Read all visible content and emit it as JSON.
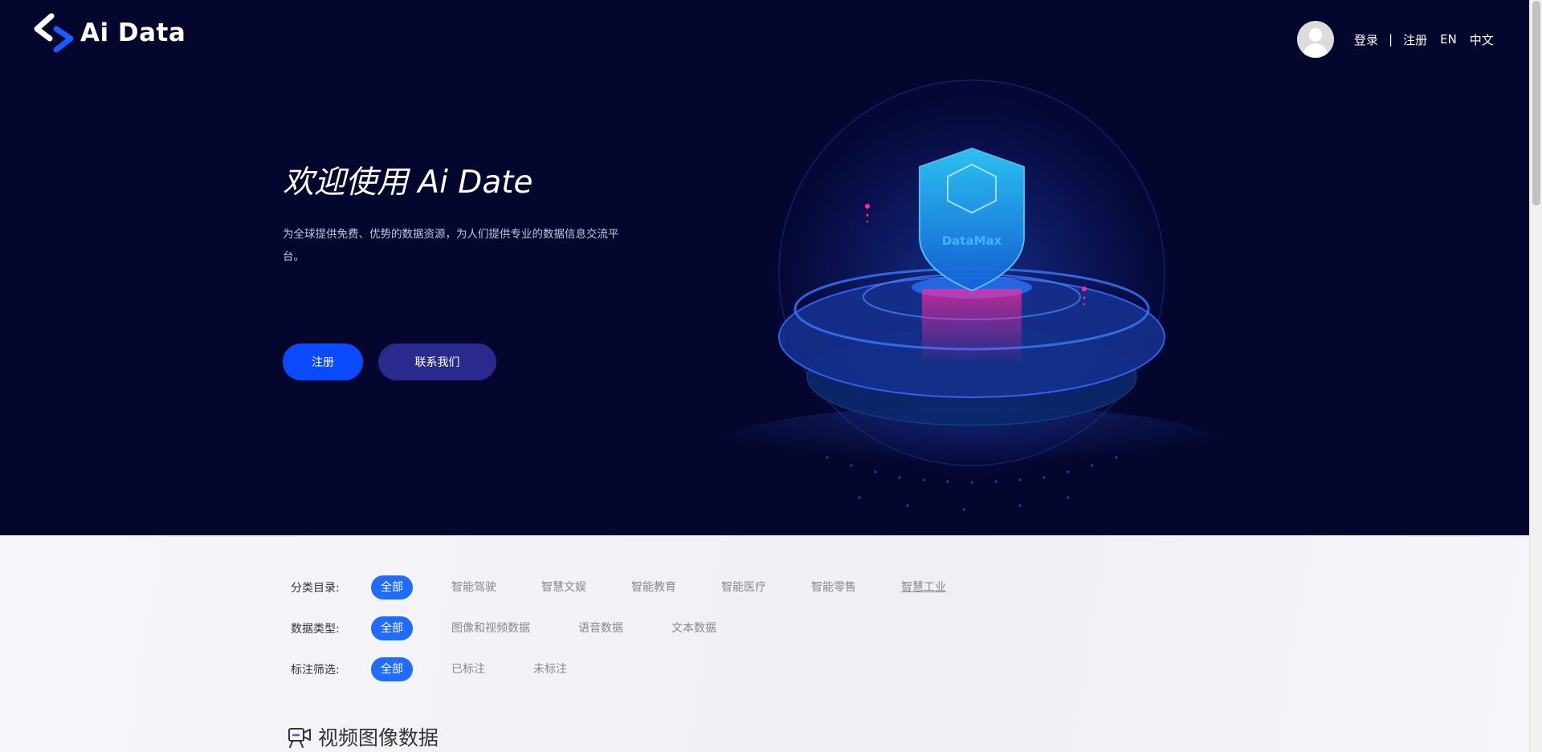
{
  "header": {
    "logo_text": "Ai Data",
    "nav": {
      "login": "登录",
      "separator": "|",
      "register": "注册",
      "lang_en": "EN",
      "lang_zh": "中文"
    }
  },
  "hero": {
    "title": "欢迎使用 Ai Date",
    "description": "为全球提供免费、优势的数据资源，为人们提供专业的数据信息交流平台。",
    "register_button": "注册",
    "contact_button": "联系我们",
    "illustration_label": "DataMax"
  },
  "filters": {
    "category": {
      "label": "分类目录:",
      "options": [
        "全部",
        "智能驾驶",
        "智慧文娱",
        "智能教育",
        "智能医疗",
        "智能零售",
        "智慧工业"
      ],
      "selected": "全部"
    },
    "data_type": {
      "label": "数据类型:",
      "options": [
        "全部",
        "图像和视频数据",
        "语音数据",
        "文本数据"
      ],
      "selected": "全部"
    },
    "annotation": {
      "label": "标注筛选:",
      "options": [
        "全部",
        "已标注",
        "未标注"
      ],
      "selected": "全部"
    }
  },
  "section": {
    "title": "视频图像数据",
    "icon": "video-camera-icon"
  },
  "colors": {
    "hero_bg": "#04062e",
    "primary": "#0a4bff",
    "secondary": "#2a2a8e",
    "chip_active": "#1f6cff"
  }
}
